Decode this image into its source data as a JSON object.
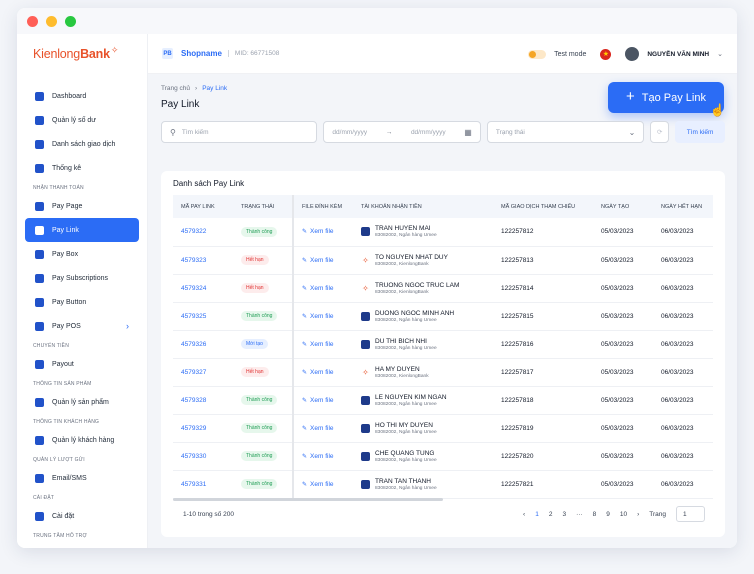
{
  "brand": {
    "name_light": "Kienlong",
    "name_bold": "Bank",
    "accent": "#e8522a"
  },
  "topbar": {
    "shop_icon": "PB",
    "shopname": "Shopname",
    "mid": "MID: 66771508",
    "test_mode_label": "Test mode",
    "flag": "★",
    "username": "NGUYỄN VĂN MINH",
    "chevron": "⌄"
  },
  "sidebar": {
    "items": [
      {
        "label": "Dashboard",
        "icon": "dashboard-icon"
      },
      {
        "label": "Quản lý số dư",
        "icon": "wallet-icon"
      },
      {
        "label": "Danh sách giao dịch",
        "icon": "list-icon"
      },
      {
        "label": "Thống kê",
        "icon": "chart-icon"
      }
    ],
    "section_payment": "NHẬN THANH TOÁN",
    "payment_items": [
      {
        "label": "Pay Page",
        "icon": "page-icon"
      },
      {
        "label": "Pay Link",
        "icon": "link-icon",
        "active": true
      },
      {
        "label": "Pay Box",
        "icon": "box-icon"
      },
      {
        "label": "Pay Subscriptions",
        "icon": "subscription-icon"
      },
      {
        "label": "Pay Button",
        "icon": "button-icon"
      },
      {
        "label": "Pay POS",
        "icon": "pos-icon",
        "chevron": "›"
      }
    ],
    "section_transfer": "CHUYỂN TIỀN",
    "payout": "Payout",
    "section_product": "THÔNG TIN SẢN PHẨM",
    "product": "Quản lý sản phẩm",
    "section_customer": "THÔNG TIN KHÁCH HÀNG",
    "customer": "Quản lý khách hàng",
    "section_mail": "QUẢN LÝ LƯỢT GỬI",
    "email": "Email/SMS",
    "section_settings": "CÀI ĐẶT",
    "settings": "Cài đặt",
    "section_support": "TRUNG TÂM HỖ TRỢ"
  },
  "breadcrumb": {
    "home": "Trang chủ",
    "sep": "›",
    "current": "Pay Link"
  },
  "page_title": "Pay Link",
  "create_button": {
    "plus": "+",
    "label": "Tạo Pay Link"
  },
  "filters": {
    "search_placeholder": "Tìm kiếm",
    "date_from": "dd/mm/yyyy",
    "arrow": "→",
    "date_to": "dd/mm/yyyy",
    "status_placeholder": "Trạng thái",
    "refresh": "⟳",
    "search_button": "Tìm kiếm"
  },
  "table": {
    "title": "Danh sách Pay Link",
    "headers": [
      "MÃ PAY LINK",
      "TRẠNG THÁI",
      "FILE ĐÍNH KÈM",
      "TÀI KHOẢN NHẬN TIỀN",
      "MÃ GIAO DỊCH THAM CHIẾU",
      "NGÀY TẠO",
      "NGÀY HẾT HẠN"
    ],
    "rows": [
      {
        "code": "4579322",
        "status": "Thành công",
        "status_type": "ok",
        "file": "Xem file",
        "bank": "umee",
        "name": "TRAN HUYEN MAI",
        "sub": "83082002, Ngân hàng Umee",
        "ref": "122257812",
        "created": "05/03/2023",
        "expires": "06/03/2023"
      },
      {
        "code": "4579323",
        "status": "Hết hạn",
        "status_type": "exp",
        "file": "Xem file",
        "bank": "klb",
        "name": "TO NGUYEN NHAT DUY",
        "sub": "83082002, KienlongBank",
        "ref": "122257813",
        "created": "05/03/2023",
        "expires": "06/03/2023"
      },
      {
        "code": "4579324",
        "status": "Hết hạn",
        "status_type": "exp",
        "file": "Xem file",
        "bank": "klb",
        "name": "TRUONG NGOC TRUC LAM",
        "sub": "83082002, KienlongBank",
        "ref": "122257814",
        "created": "05/03/2023",
        "expires": "06/03/2023"
      },
      {
        "code": "4579325",
        "status": "Thành công",
        "status_type": "ok",
        "file": "Xem file",
        "bank": "umee",
        "name": "DUONG NGOC MINH ANH",
        "sub": "83082002, Ngân hàng Umee",
        "ref": "122257815",
        "created": "05/03/2023",
        "expires": "06/03/2023"
      },
      {
        "code": "4579326",
        "status": "Mới tạo",
        "status_type": "new",
        "file": "Xem file",
        "bank": "umee",
        "name": "DU THI BICH NHI",
        "sub": "83082002, Ngân hàng Umee",
        "ref": "122257816",
        "created": "05/03/2023",
        "expires": "06/03/2023"
      },
      {
        "code": "4579327",
        "status": "Hết hạn",
        "status_type": "exp",
        "file": "Xem file",
        "bank": "klb",
        "name": "HA MY DUYEN",
        "sub": "83082002, KienlongBank",
        "ref": "122257817",
        "created": "05/03/2023",
        "expires": "06/03/2023"
      },
      {
        "code": "4579328",
        "status": "Thành công",
        "status_type": "ok",
        "file": "Xem file",
        "bank": "umee",
        "name": "LE NGUYEN KIM NGAN",
        "sub": "83082002, Ngân hàng Umee",
        "ref": "122257818",
        "created": "05/03/2023",
        "expires": "06/03/2023"
      },
      {
        "code": "4579329",
        "status": "Thành công",
        "status_type": "ok",
        "file": "Xem file",
        "bank": "umee",
        "name": "HO THI MY DUYEN",
        "sub": "83082002, Ngân hàng Umee",
        "ref": "122257819",
        "created": "05/03/2023",
        "expires": "06/03/2023"
      },
      {
        "code": "4579330",
        "status": "Thành công",
        "status_type": "ok",
        "file": "Xem file",
        "bank": "umee",
        "name": "CHE QUANG TUNG",
        "sub": "83082002, Ngân hàng Umee",
        "ref": "122257820",
        "created": "05/03/2023",
        "expires": "06/03/2023"
      },
      {
        "code": "4579331",
        "status": "Thành công",
        "status_type": "ok",
        "file": "Xem file",
        "bank": "umee",
        "name": "TRAN TAN THANH",
        "sub": "83082002, Ngân hàng Umee",
        "ref": "122257821",
        "created": "05/03/2023",
        "expires": "06/03/2023"
      }
    ]
  },
  "pagination": {
    "info": "1-10 trong số 200",
    "prev": "‹",
    "pages": [
      "1",
      "2",
      "3",
      "···",
      "8",
      "9",
      "10"
    ],
    "next": "›",
    "goto_label": "Trang",
    "goto_value": "1"
  }
}
